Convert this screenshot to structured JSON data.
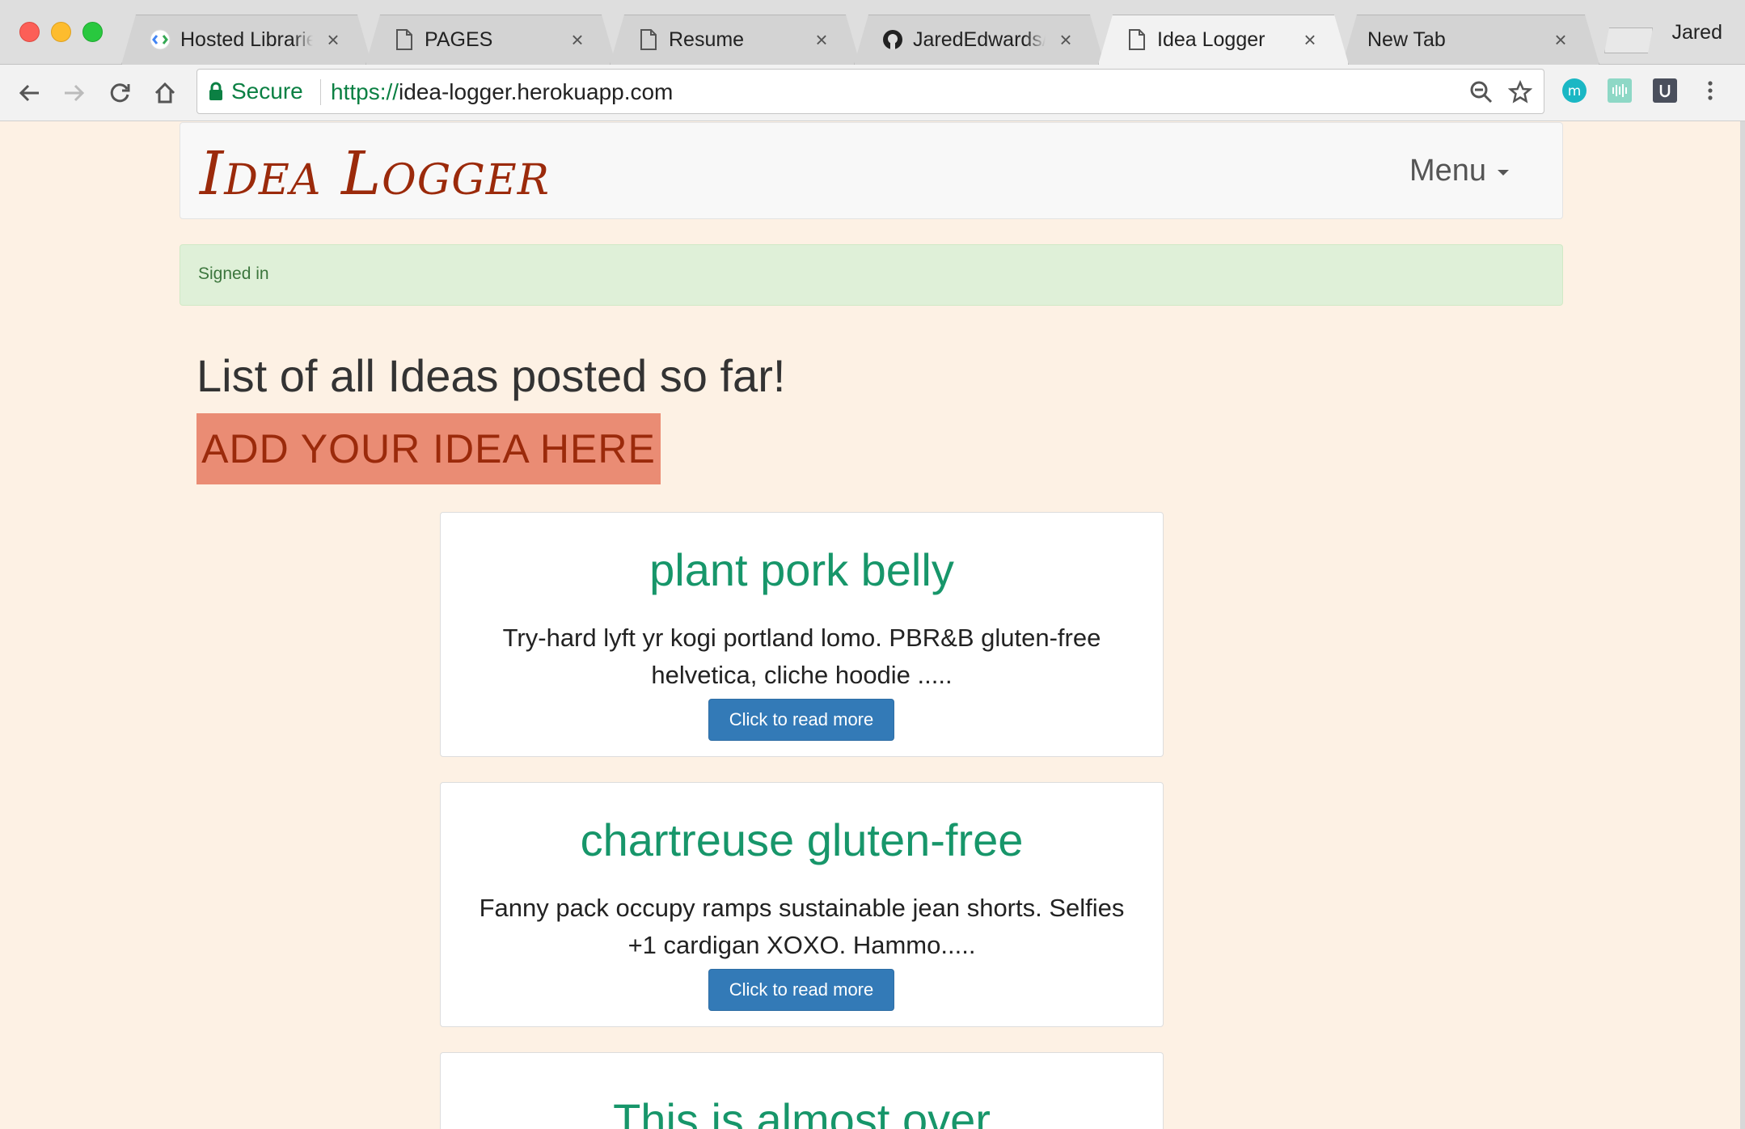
{
  "browser": {
    "tabs": [
      {
        "title": "Hosted Libraries",
        "icon": "google-developers-icon"
      },
      {
        "title": "PAGES",
        "icon": "page-icon"
      },
      {
        "title": "Resume",
        "icon": "page-icon"
      },
      {
        "title": "JaredEdwards/pr",
        "icon": "github-icon"
      },
      {
        "title": "Idea Logger",
        "icon": "page-icon",
        "active": true
      },
      {
        "title": "New Tab",
        "icon": ""
      }
    ],
    "tab_close": "×",
    "profile_name": "Jared",
    "secure_label": "Secure",
    "url_scheme": "https://",
    "url_host": "idea-logger.herokuapp.com",
    "accent_secure": "#0b8043"
  },
  "site": {
    "brand": "Idea Logger",
    "menu_label": "Menu",
    "alert": "Signed in",
    "list_title": "List of all Ideas posted so far!",
    "add_idea": "ADD YOUR IDEA HERE"
  },
  "ideas": [
    {
      "title": "plant pork belly",
      "body": "Try-hard lyft yr kogi portland lomo. PBR&B gluten-free helvetica, cliche hoodie .....",
      "button": "Click to read more"
    },
    {
      "title": "chartreuse gluten-free",
      "body": "Fanny pack occupy ramps sustainable jean shorts. Selfies +1 cardigan XOXO. Hammo.....",
      "button": "Click to read more"
    },
    {
      "title": "This is almost over",
      "body": "",
      "button": ""
    }
  ],
  "colors": {
    "page_bg": "#fdf1e4",
    "brand": "#9b2a0b",
    "idea_title": "#17966a",
    "add_button_bg": "#ea8c74",
    "read_button_bg": "#337ab7"
  }
}
